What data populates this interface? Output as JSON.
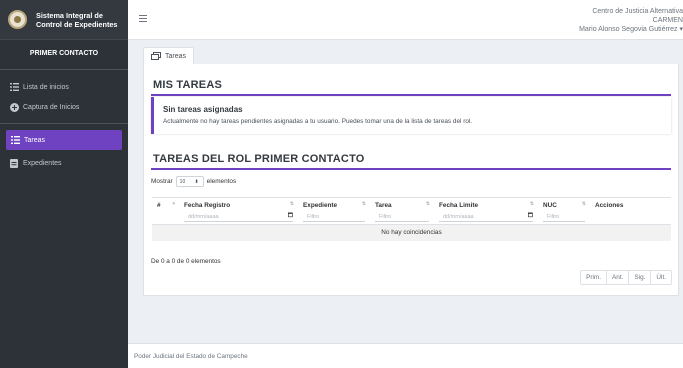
{
  "brand": {
    "title_line1": "Sistema Integral de",
    "title_line2": "Control de Expedientes"
  },
  "sidebar": {
    "section_title": "PRIMER CONTACTO",
    "items": [
      {
        "label": "Lista de inicios",
        "icon": "list-icon"
      },
      {
        "label": "Captura de Inicios",
        "icon": "plus-circle-icon"
      },
      {
        "label": "Tareas",
        "icon": "tasks-icon",
        "active": true
      },
      {
        "label": "Expedientes",
        "icon": "file-icon"
      }
    ]
  },
  "header": {
    "org_name": "Centro de Justicia Alternativa",
    "user_role": "CARMEN",
    "user_name": "Mario Alonso Segovia Gutiérrez"
  },
  "tab": {
    "label": "Tareas"
  },
  "my_tasks": {
    "heading": "MIS TAREAS",
    "callout_title": "Sin tareas asignadas",
    "callout_text": "Actualmente no hay tareas pendientes asignadas a tu usuario. Puedes tomar una de la lista de tareas del rol."
  },
  "role_tasks": {
    "heading": "TAREAS DEL ROL PRIMER CONTACTO",
    "show_label": "Mostrar",
    "show_value": "10",
    "show_suffix": "elementos",
    "columns": [
      {
        "label": "#",
        "filter": ""
      },
      {
        "label": "Fecha Registro",
        "filter": "dd/mm/aaaa"
      },
      {
        "label": "Expediente",
        "filter": "Filtro"
      },
      {
        "label": "Tarea",
        "filter": "Filtro"
      },
      {
        "label": "Fecha Limite",
        "filter": "dd/mm/aaaa"
      },
      {
        "label": "NUC",
        "filter": "Filtro"
      },
      {
        "label": "Acciones",
        "filter": ""
      }
    ],
    "empty_text": "No hay coincidencias",
    "info_text": "De 0 a 0 de 0 elementos",
    "pager": {
      "first": "Prim.",
      "prev": "Ant.",
      "next": "Sig.",
      "last": "Últ."
    }
  },
  "footer": {
    "text": "Poder Judicial del Estado de Campeche"
  },
  "colors": {
    "accent": "#6f42c1",
    "sidebar_bg": "#2d3238"
  }
}
